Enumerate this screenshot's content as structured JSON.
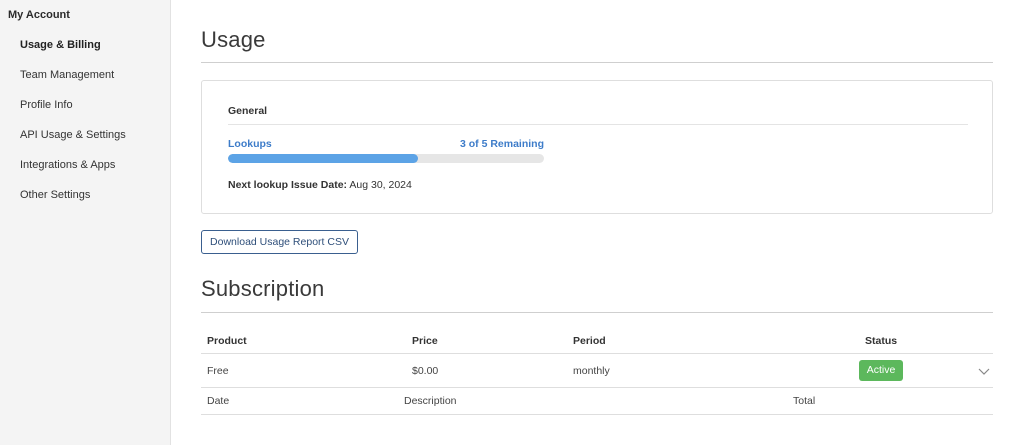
{
  "sidebar": {
    "heading": "My Account",
    "items": [
      {
        "label": "Usage & Billing"
      },
      {
        "label": "Team Management"
      },
      {
        "label": "Profile Info"
      },
      {
        "label": "API Usage & Settings"
      },
      {
        "label": "Integrations & Apps"
      },
      {
        "label": "Other Settings"
      }
    ]
  },
  "usage": {
    "title": "Usage",
    "card_header": "General",
    "lookups_label": "Lookups",
    "lookups_remaining": "3 of 5 Remaining",
    "lookups_progress_fraction": 0.6,
    "next_issue_label": "Next lookup Issue Date:",
    "next_issue_date": "Aug 30, 2024",
    "download_button": "Download Usage Report CSV"
  },
  "subscription": {
    "title": "Subscription",
    "columns": {
      "product": "Product",
      "price": "Price",
      "period": "Period",
      "status": "Status"
    },
    "row": {
      "product": "Free",
      "price": "$0.00",
      "period": "monthly",
      "status": "Active"
    },
    "detail_columns": {
      "date": "Date",
      "description": "Description",
      "total": "Total"
    }
  },
  "colors": {
    "accent_blue": "#3d7cc9",
    "progress_fill": "#5ca3e6",
    "status_active": "#5cb85c",
    "button_border": "#3a5f8f"
  },
  "icons": {
    "row_expand": "chevron-down-icon"
  }
}
